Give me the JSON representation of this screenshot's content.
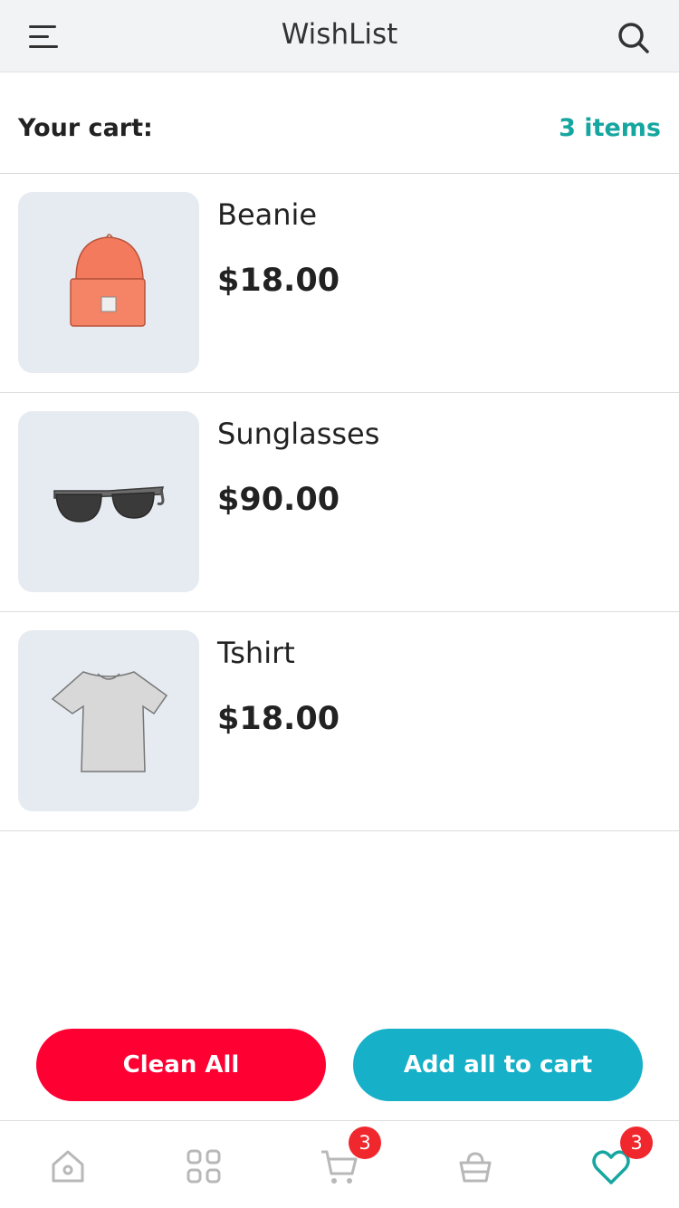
{
  "header": {
    "title": "WishList",
    "menu_icon": "hamburger-menu-icon",
    "search_icon": "search-icon"
  },
  "cart": {
    "label": "Your cart:",
    "count": "3 items",
    "count_color": "#16a6a0"
  },
  "items": [
    {
      "name": "Beanie",
      "price": "$18.00",
      "image": "beanie-image"
    },
    {
      "name": "Sunglasses",
      "price": "$90.00",
      "image": "sunglasses-image"
    },
    {
      "name": "Tshirt",
      "price": "$18.00",
      "image": "tshirt-image"
    }
  ],
  "actions": {
    "clean_label": "Clean All",
    "clean_color": "#ff0033",
    "add_label": "Add all to cart",
    "add_color": "#16b0c8"
  },
  "tabbar": {
    "tabs": [
      {
        "icon": "home-icon"
      },
      {
        "icon": "grid-icon"
      },
      {
        "icon": "cart-icon",
        "badge": "3"
      },
      {
        "icon": "basket-icon"
      },
      {
        "icon": "heart-icon",
        "badge": "3",
        "active": true
      }
    ],
    "badge_color": "#f0272d",
    "active_color": "#16a6a0"
  }
}
